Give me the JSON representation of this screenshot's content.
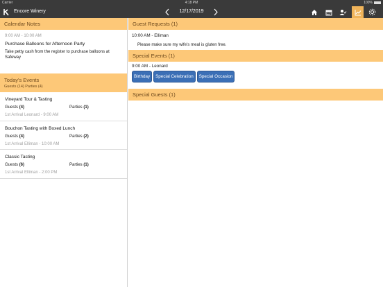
{
  "status_bar": {
    "carrier": "Carrier",
    "time": "4:18 PM",
    "battery": "100%"
  },
  "nav": {
    "title": "Encore Winery",
    "date": "12/17/2019",
    "icons": [
      "home-icon",
      "calendar-icon",
      "user-check-icon",
      "chart-icon",
      "settings-icon"
    ],
    "active_icon": "chart-icon",
    "accent": "#f0b45a",
    "bar_color": "#3a3a3a"
  },
  "calendar_notes": {
    "header": "Calendar Notes",
    "time": "9:00 AM - 10:00 AM",
    "title": "Purchase Balloons for Afternoon Party",
    "body": "Take petty cash from the register to purchase balloons at Safeway"
  },
  "todays_events": {
    "header": "Today's Events",
    "subheader": "Guests (14) Parties (4)",
    "guests_label": "Guests",
    "parties_label": "Parties",
    "items": [
      {
        "name": "Vineyard Tour & Tasting",
        "guests": "(4)",
        "parties": "(1)",
        "arrival": "1st Arrival Leonard - 9:00 AM"
      },
      {
        "name": "Bouchon Tasting with Boxed Lunch",
        "guests": "(4)",
        "parties": "(2)",
        "arrival": "1st Arrival Elliman - 10:00 AM"
      },
      {
        "name": "Classic Tasting",
        "guests": "(6)",
        "parties": "(1)",
        "arrival": "1st Arrival Elliman - 2:00 PM"
      }
    ]
  },
  "guest_requests": {
    "header": "Guest Requests (1)",
    "time": "10:00 AM - Elliman",
    "text": "Please make sure my wife's meal is gluten free."
  },
  "special_events": {
    "header": "Special Events (1)",
    "time": "9:00 AM - Leonard",
    "tags": [
      "Birthday",
      "Special Celebration",
      "Special Occasion"
    ],
    "tag_color": "#3b6fb6"
  },
  "special_guests": {
    "header": "Special Guests (1)"
  },
  "colors": {
    "section_header_bg": "#fdc878",
    "section_header_text": "#6e4a1e"
  }
}
